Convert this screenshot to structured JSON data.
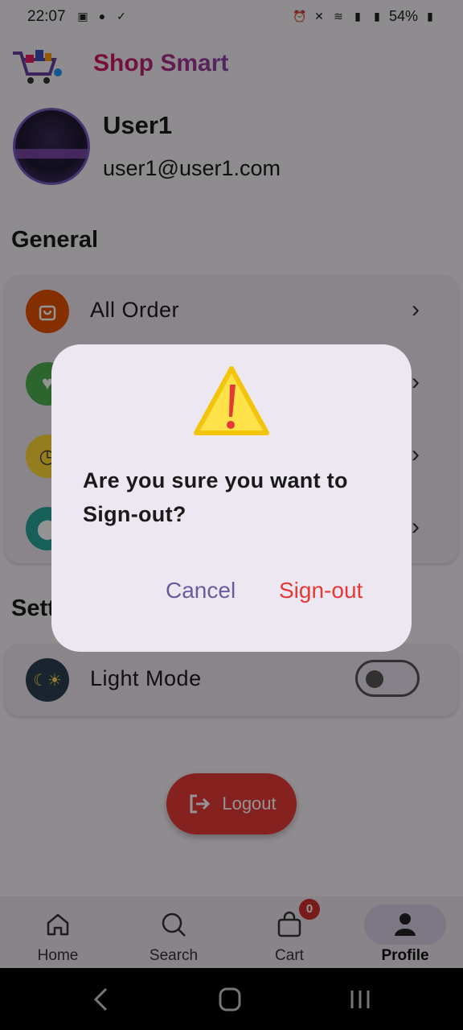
{
  "status": {
    "time": "22:07",
    "battery": "54%"
  },
  "header": {
    "title": "Shop Smart"
  },
  "profile": {
    "name": "User1",
    "email": "user1@user1.com"
  },
  "general": {
    "title": "General",
    "items": [
      {
        "label": "All Order",
        "color": "#e65100"
      }
    ]
  },
  "settings": {
    "title_visible": "Sett",
    "light_mode_label": "Light Mode"
  },
  "logout": {
    "label": "Logout"
  },
  "nav": {
    "items": [
      {
        "label": "Home"
      },
      {
        "label": "Search"
      },
      {
        "label": "Cart"
      },
      {
        "label": "Profile"
      }
    ],
    "cart_badge": "0"
  },
  "dialog": {
    "message": "Are you sure you want to Sign-out?",
    "cancel_label": "Cancel",
    "confirm_label": "Sign-out"
  },
  "colors": {
    "accent": "#6a5b9c",
    "danger": "#e53935"
  }
}
